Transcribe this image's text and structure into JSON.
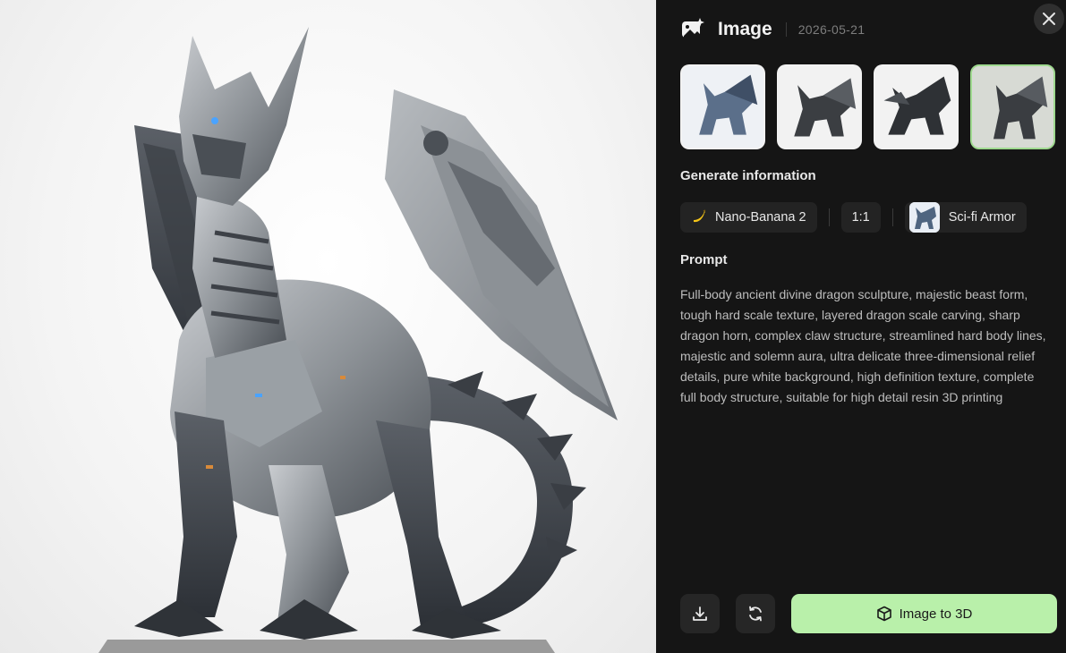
{
  "header": {
    "icon": "image-sparkle-icon",
    "title": "Image",
    "date": "2026-05-21"
  },
  "close": {
    "icon": "close-icon"
  },
  "thumbnails": [
    {
      "name": "dragon-variant-1",
      "active": false
    },
    {
      "name": "dragon-variant-2",
      "active": false
    },
    {
      "name": "dragon-variant-3",
      "active": false
    },
    {
      "name": "dragon-variant-4",
      "active": true
    }
  ],
  "generate_info": {
    "title": "Generate information",
    "model": {
      "icon": "banana-icon",
      "label": "Nano-Banana 2"
    },
    "ratio": "1:1",
    "style": {
      "label": "Sci-fi Armor"
    }
  },
  "prompt": {
    "title": "Prompt",
    "text": "Full-body ancient divine dragon sculpture, majestic beast form, tough hard scale texture, layered dragon scale carving, sharp dragon horn, complex claw structure, streamlined hard body lines, majestic and solemn aura, ultra delicate three-dimensional relief details, pure white background, high definition texture, complete full body structure, suitable for high detail resin 3D printing"
  },
  "actions": {
    "download_icon": "download-icon",
    "regenerate_icon": "refresh-icon",
    "primary_label": "Image to 3D",
    "primary_icon": "cube-icon",
    "accent": "#b9f0aa"
  }
}
